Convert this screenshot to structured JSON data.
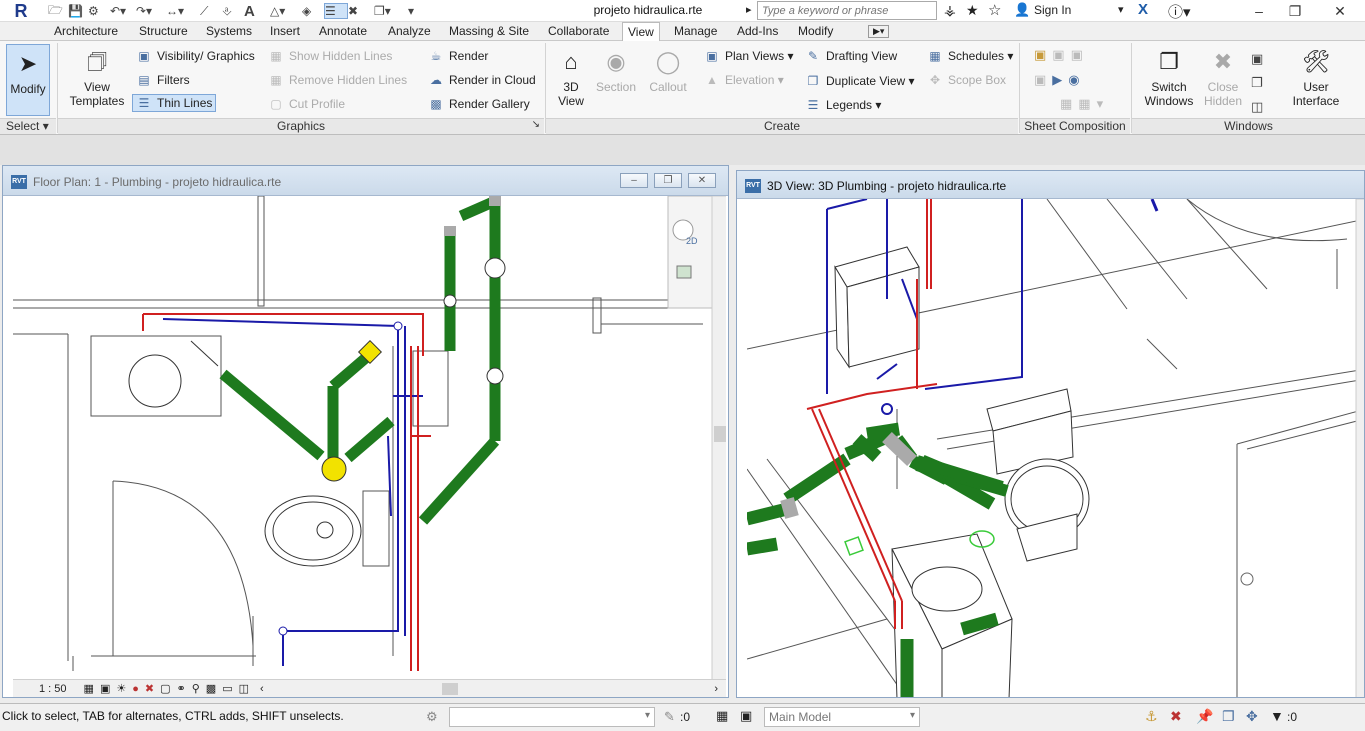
{
  "app": {
    "logo": "R",
    "document_title": "projeto hidraulica.rte",
    "search_placeholder": "Type a keyword or phrase",
    "sign_in": "Sign In"
  },
  "menu_tabs": [
    "Architecture",
    "Structure",
    "Systems",
    "Insert",
    "Annotate",
    "Analyze",
    "Massing & Site",
    "Collaborate",
    "View",
    "Manage",
    "Add-Ins",
    "Modify"
  ],
  "active_tab": "View",
  "ribbon": {
    "select": {
      "modify": "Modify",
      "panel": "Select"
    },
    "graphics": {
      "view_templates": "View Templates",
      "visibility": "Visibility/ Graphics",
      "filters": "Filters",
      "thin_lines": "Thin Lines",
      "show_hidden": "Show Hidden Lines",
      "remove_hidden": "Remove Hidden Lines",
      "cut_profile": "Cut Profile",
      "render": "Render",
      "render_cloud": "Render in Cloud",
      "render_gallery": "Render Gallery",
      "panel": "Graphics"
    },
    "create": {
      "view3d": "3D View",
      "section": "Section",
      "callout": "Callout",
      "plan_views": "Plan Views",
      "elevation": "Elevation",
      "drafting_view": "Drafting View",
      "duplicate_view": "Duplicate View",
      "legends": "Legends",
      "schedules": "Schedules",
      "scope_box": "Scope Box",
      "panel": "Create"
    },
    "sheet": {
      "panel": "Sheet Composition"
    },
    "windows": {
      "switch": "Switch Windows",
      "close_hidden": "Close Hidden",
      "user_interface": "User Interface",
      "panel": "Windows"
    }
  },
  "views": {
    "floor_plan": {
      "title": "Floor Plan: 1 - Plumbing - projeto hidraulica.rte",
      "scale": "1 : 50",
      "cube_label": "2D"
    },
    "view_3d": {
      "title": "3D View: 3D Plumbing - projeto hidraulica.rte"
    }
  },
  "status": {
    "hint": "Click to select, TAB for alternates, CTRL adds, SHIFT unselects.",
    "count1": ":0",
    "model": "Main Model",
    "count2": ":0"
  },
  "colors": {
    "pipe_green": "#1e7a1e",
    "cold_water": "#1a1aa8",
    "hot_water": "#d02020",
    "fixture": "#f2e200",
    "accent": "#cfe3f8"
  }
}
